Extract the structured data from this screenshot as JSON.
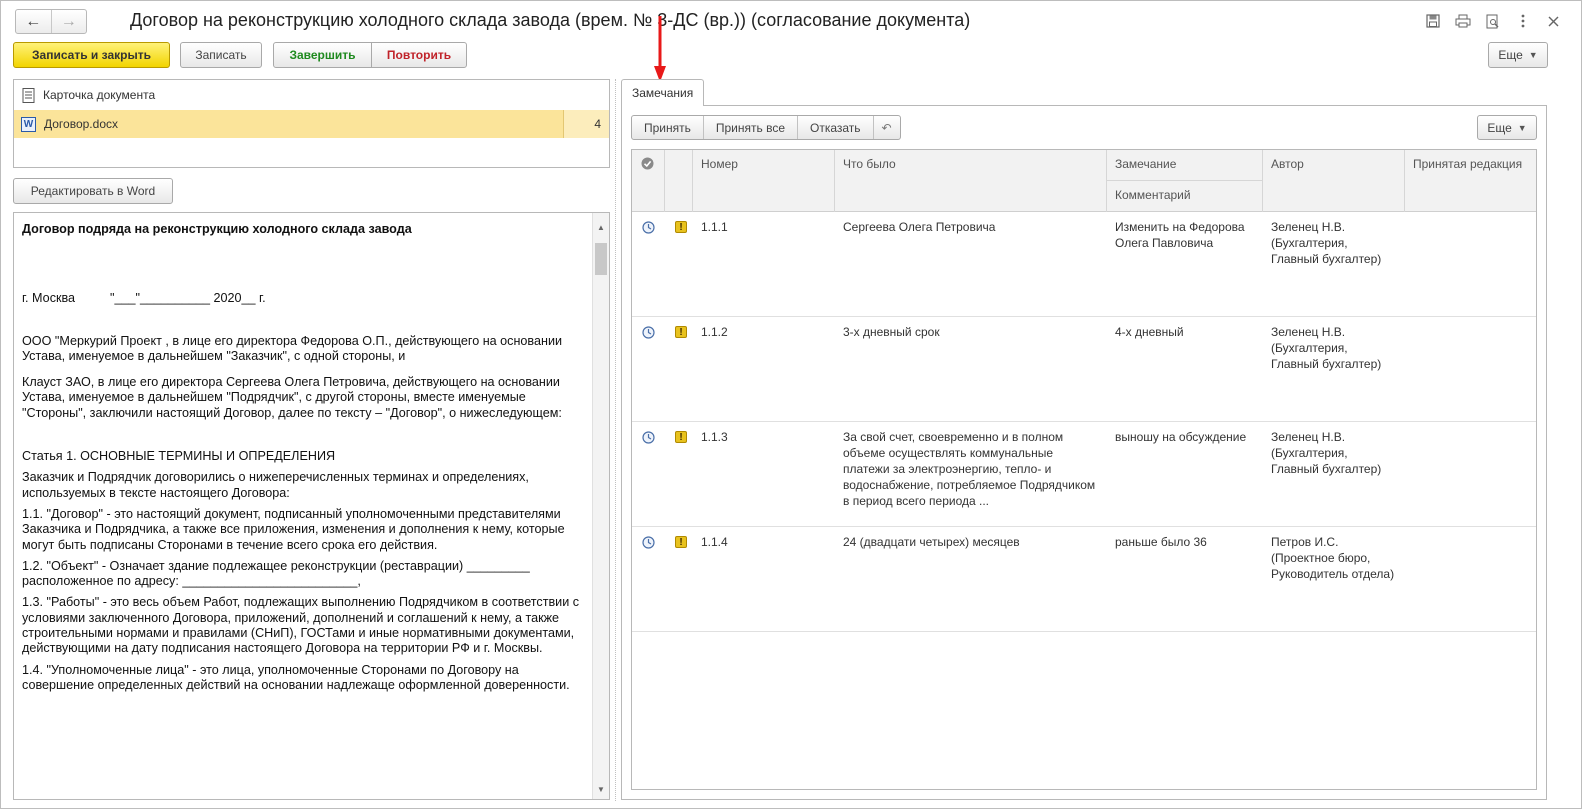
{
  "window": {
    "title": "Договор на реконструкцию холодного склада завода (врем. № 3-ДС (вр.)) (согласование документа)",
    "back_icon": "←",
    "forward_icon": "→",
    "icons": [
      "save-icon",
      "print-icon",
      "preview-icon",
      "more-vert-icon",
      "close-icon"
    ]
  },
  "toolbar": {
    "save_close": "Записать и закрыть",
    "save": "Записать",
    "finish": "Завершить",
    "repeat": "Повторить",
    "more": "Еще"
  },
  "documents": {
    "card_label": "Карточка документа",
    "file_label": "Договор.docx",
    "file_count": "4",
    "edit_button": "Редактировать в Word"
  },
  "doc_text": {
    "title": "Договор подряда на реконструкцию холодного склада завода",
    "city_line": "г. Москва          \"___\"__________ 2020__ г.",
    "p1": "ООО \"Меркурий Проект , в лице его директора Федорова О.П., действующего на основании Устава, именуемое в дальнейшем \"Заказчик\", с одной стороны, и",
    "p2": "Клауст ЗАО, в лице его директора Сергеева  Олега Петровича, действующего на основании Устава, именуемое в дальнейшем \"Подрядчик\", с другой стороны, вместе именуемые \"Стороны\", заключили настоящий Договор,  далее по тексту – \"Договор\",  о нижеследующем:",
    "article1": "Статья 1. ОСНОВНЫЕ ТЕРМИНЫ И ОПРЕДЕЛЕНИЯ",
    "p3": "Заказчик и Подрядчик договорились о нижеперечисленных терминах и определениях, используемых в тексте настоящего Договора:",
    "p4": "1.1. \"Договор\" - это настоящий документ, подписанный уполномоченными представителями Заказчика и Подрядчика, а также все приложения, изменения и дополнения к нему, которые могут быть подписаны Сторонами в течение всего срока его действия.",
    "p5": "1.2. \"Объект\" - Означает здание подлежащее реконструкции (реставрации) _________ расположенное по адресу: _________________________,",
    "p6": "1.3. \"Работы\" - это весь объем Работ, подлежащих выполнению Подрядчиком в соответствии с условиями заключенного Договора, приложений, дополнений и соглашений к нему, а также строительными нормами и правилами (СНиП), ГОСТами и иные нормативными документами, действующими на дату подписания настоящего Договора на территории РФ и г. Москвы.",
    "p7": "1.4. \"Уполномоченные лица\" - это лица, уполномоченные Сторонами по Договору на совершение определенных действий на основании надлежаще оформленной доверенности."
  },
  "remarks": {
    "tab_label": "Замечания",
    "accept": "Принять",
    "accept_all": "Принять все",
    "reject": "Отказать",
    "undo_icon": "↶",
    "more": "Еще",
    "columns": {
      "number": "Номер",
      "was": "Что было",
      "remark": "Замечание",
      "comment": "Комментарий",
      "author": "Автор",
      "accepted": "Принятая редакция"
    },
    "rows": [
      {
        "number": "1.1.1",
        "was": "Сергеева Олега Петровича",
        "remark": "Изменить на Федорова Олега Павловича",
        "author": "Зеленец Н.В. (Бухгалтерия, Главный бухгалтер)",
        "accepted": ""
      },
      {
        "number": "1.1.2",
        "was": "3-х дневный срок",
        "remark": "4-х дневный",
        "author": "Зеленец Н.В. (Бухгалтерия, Главный бухгалтер)",
        "accepted": ""
      },
      {
        "number": "1.1.3",
        "was": "За свой счет, своевременно и в полном объеме осуществлять коммунальные платежи за электроэнергию, тепло- и водоснабжение, потребляемое Подрядчиком в  период всего периода ...",
        "remark": "выношу на обсуждение",
        "author": "Зеленец Н.В. (Бухгалтерия, Главный бухгалтер)",
        "accepted": ""
      },
      {
        "number": "1.1.4",
        "was": "24 (двадцати четырех) месяцев",
        "remark": "раньше было 36",
        "author": "Петров И.С. (Проектное бюро, Руководитель отдела)",
        "accepted": ""
      }
    ]
  }
}
